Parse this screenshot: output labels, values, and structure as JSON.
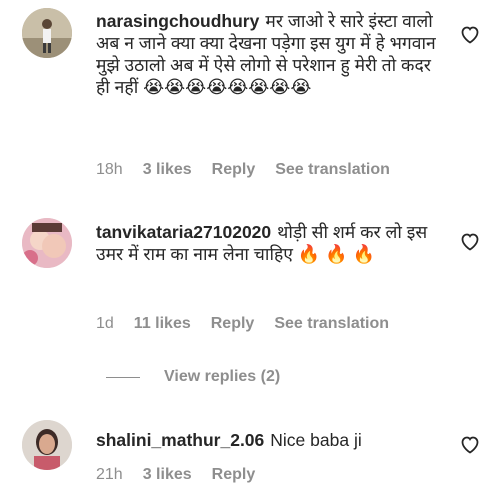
{
  "comments": [
    {
      "username": "narasingchoudhury",
      "text": "मर जाओ रे सारे इंस्टा वालो अब न जाने क्या क्या देखना पड़ेगा इस युग में हे भगवान मुझे उठालो अब में ऐसे लोगो से परेशान हु मेरी तो कदर ही नहीं",
      "emoji": "😭😭😭😭😭😭😭😭",
      "time": "18h",
      "likes": "3 likes",
      "reply": "Reply",
      "translation": "See translation",
      "avatar_icon": "user-photo-avatar",
      "like_icon": "heart-outline-icon"
    },
    {
      "username": "tanvikataria27102020",
      "text": "थोड़ी सी शर्म कर लो इस उमर में राम का नाम लेना चाहिए",
      "emoji": "🔥 🔥 🔥",
      "time": "1d",
      "likes": "11 likes",
      "reply": "Reply",
      "translation": "See translation",
      "avatar_icon": "user-photo-avatar",
      "like_icon": "heart-outline-icon"
    },
    {
      "username": "shalini_mathur_2.06",
      "text": "Nice baba ji",
      "emoji": "",
      "time": "21h",
      "likes": "3 likes",
      "reply": "Reply",
      "translation": "",
      "avatar_icon": "user-photo-avatar",
      "like_icon": "heart-outline-icon"
    }
  ],
  "view_replies": "View replies (2)",
  "colors": {
    "text": "#262626",
    "secondary": "#8e8e8e",
    "background": "#ffffff"
  }
}
